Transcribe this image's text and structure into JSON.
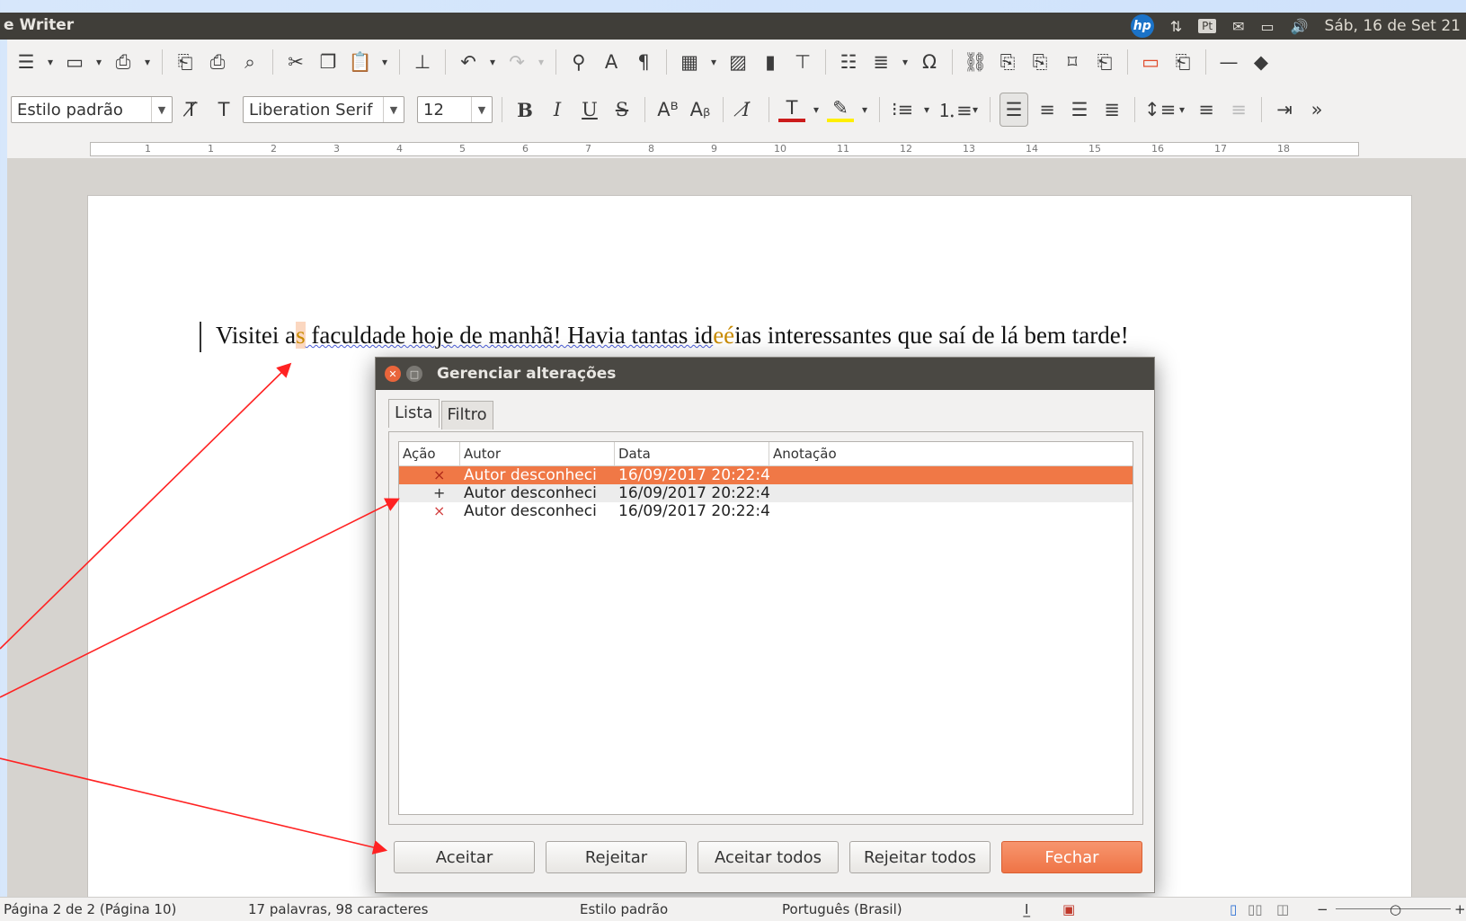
{
  "window": {
    "app_title": "e Writer"
  },
  "tray": {
    "hp_label": "hp",
    "lang": "Pt",
    "datetime": "Sáb, 16 de Set 21"
  },
  "format_bar": {
    "paragraph_style": "Estilo padrão",
    "font_name": "Liberation Serif",
    "font_size": "12"
  },
  "ruler": {
    "numbers": [
      "1",
      "1",
      "2",
      "3",
      "4",
      "5",
      "6",
      "7",
      "8",
      "9",
      "10",
      "11",
      "12",
      "13",
      "14",
      "15",
      "16",
      "17",
      "18"
    ]
  },
  "document": {
    "text_before": "Visitei a",
    "changed_char": "s",
    "text_mid": " faculdade hoje de manhã! Havia tantas id",
    "changed_word": "eé",
    "text_after": "ias interessantes que saí de lá bem tarde!"
  },
  "dialog": {
    "title": "Gerenciar alterações",
    "tabs": [
      "Lista",
      "Filtro"
    ],
    "columns": [
      "Ação",
      "Autor",
      "Data",
      "Anotação"
    ],
    "rows": [
      {
        "action": "×",
        "author": "Autor desconheci",
        "date": "16/09/2017 20:22:4",
        "note": ""
      },
      {
        "action": "+",
        "author": "Autor desconheci",
        "date": "16/09/2017 20:22:4",
        "note": ""
      },
      {
        "action": "×",
        "author": "Autor desconheci",
        "date": "16/09/2017 20:22:4",
        "note": ""
      }
    ],
    "buttons": {
      "accept": "Aceitar",
      "reject": "Rejeitar",
      "accept_all": "Aceitar todos",
      "reject_all": "Rejeitar todos",
      "close": "Fechar"
    }
  },
  "status": {
    "page": "Página 2 de 2 (Página 10)",
    "words": "17 palavras, 98 caracteres",
    "style": "Estilo padrão",
    "language": "Português (Brasil)"
  },
  "colors": {
    "accent": "#f07846",
    "arrow": "#ff2222"
  }
}
